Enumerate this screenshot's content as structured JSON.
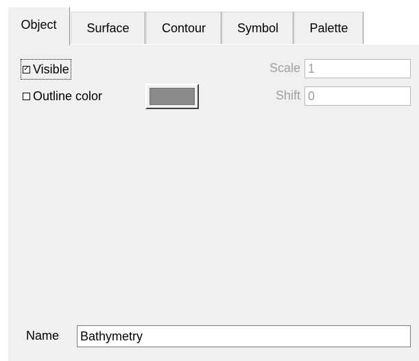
{
  "tabs": [
    {
      "label": "Object",
      "active": true
    },
    {
      "label": "Surface",
      "active": false
    },
    {
      "label": "Contour",
      "active": false
    },
    {
      "label": "Symbol",
      "active": false
    },
    {
      "label": "Palette",
      "active": false
    }
  ],
  "object": {
    "visible": {
      "label": "Visible",
      "checked": true,
      "check_glyph": "✓"
    },
    "outline": {
      "label": "Outline color",
      "checked": false,
      "swatch_color": "#8a8a8a"
    },
    "scale": {
      "label": "Scale",
      "value": "1"
    },
    "shift": {
      "label": "Shift",
      "value": "0"
    },
    "name": {
      "label": "Name",
      "value": "Bathymetry"
    }
  }
}
